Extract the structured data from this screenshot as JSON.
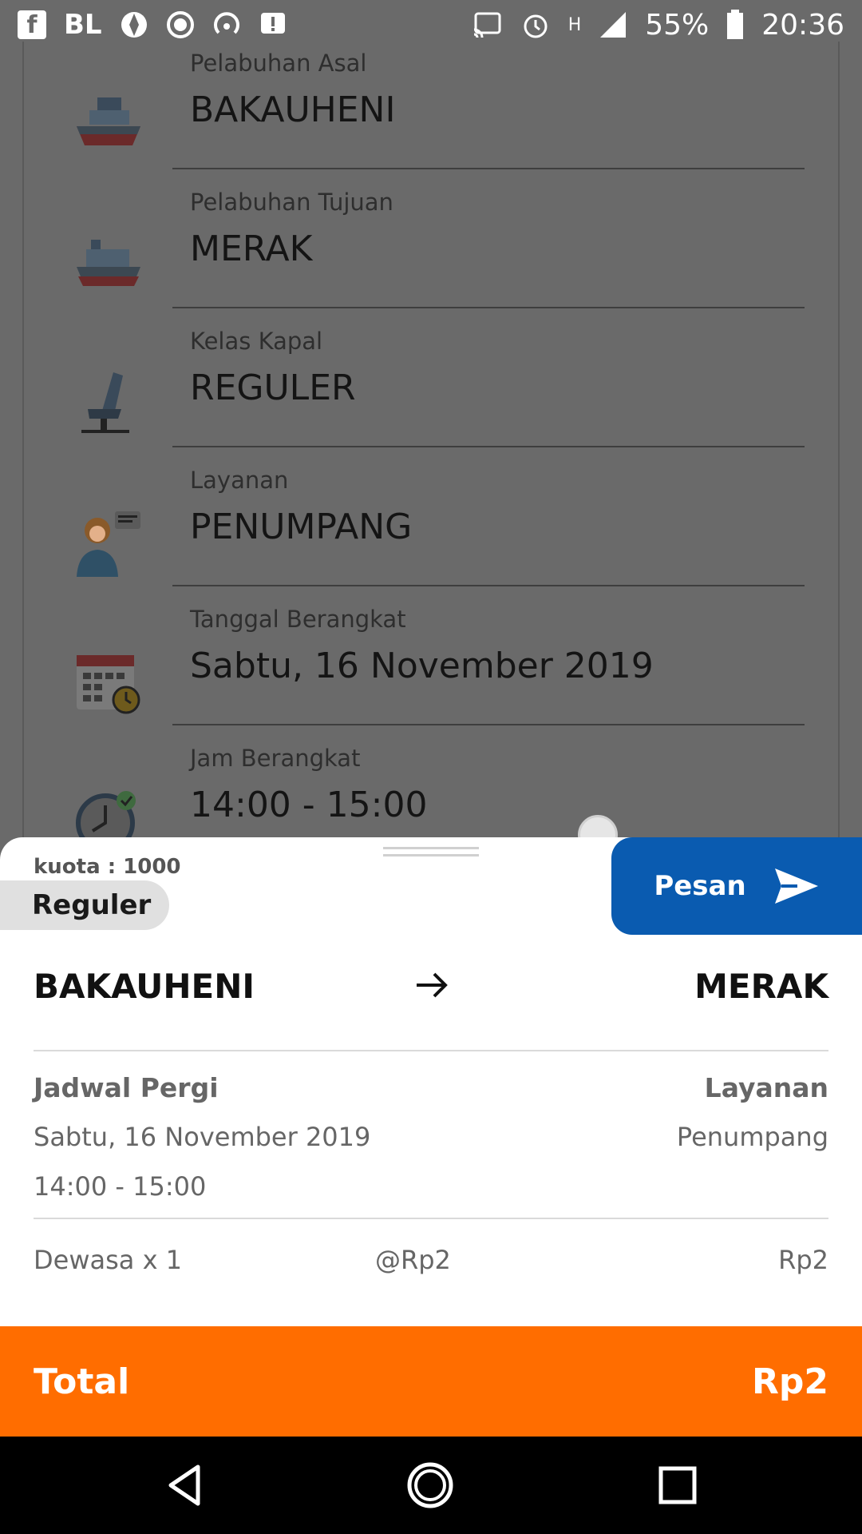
{
  "status_bar": {
    "left_icons": [
      "facebook-icon",
      "bl-icon",
      "shutter-icon",
      "record-icon",
      "hotspot-icon",
      "alert-icon"
    ],
    "bl_text": "BL",
    "battery": "55%",
    "time": "20:36",
    "signal_label": "H"
  },
  "form": {
    "fields": [
      {
        "label": "Pelabuhan Asal",
        "value": "BAKAUHENI",
        "icon": "ship-icon"
      },
      {
        "label": "Pelabuhan Tujuan",
        "value": "MERAK",
        "icon": "ship-icon"
      },
      {
        "label": "Kelas Kapal",
        "value": "REGULER",
        "icon": "seat-icon"
      },
      {
        "label": "Layanan",
        "value": "PENUMPANG",
        "icon": "service-agent-icon"
      },
      {
        "label": "Tanggal Berangkat",
        "value": "Sabtu, 16 November 2019",
        "icon": "calendar-icon"
      },
      {
        "label": "Jam Berangkat",
        "value": "14:00 - 15:00",
        "icon": "clock-icon"
      }
    ]
  },
  "sheet": {
    "kuota": "kuota : 1000",
    "class_badge": "Reguler",
    "pesan_label": "Pesan",
    "route_from": "BAKAUHENI",
    "route_to": "MERAK",
    "jadwal_label": "Jadwal Pergi",
    "jadwal_date": "Sabtu, 16 November 2019",
    "jadwal_time": "14:00 - 15:00",
    "layanan_label": "Layanan",
    "layanan_value": "Penumpang",
    "passenger_line": "Dewasa x 1",
    "unit_price": "@Rp2",
    "line_price": "Rp2",
    "total_label": "Total",
    "total_value": "Rp2"
  },
  "colors": {
    "accent_blue": "#0a5bb0",
    "total_orange": "#ff6d00",
    "overlay_gray": "#6a6a6a"
  }
}
